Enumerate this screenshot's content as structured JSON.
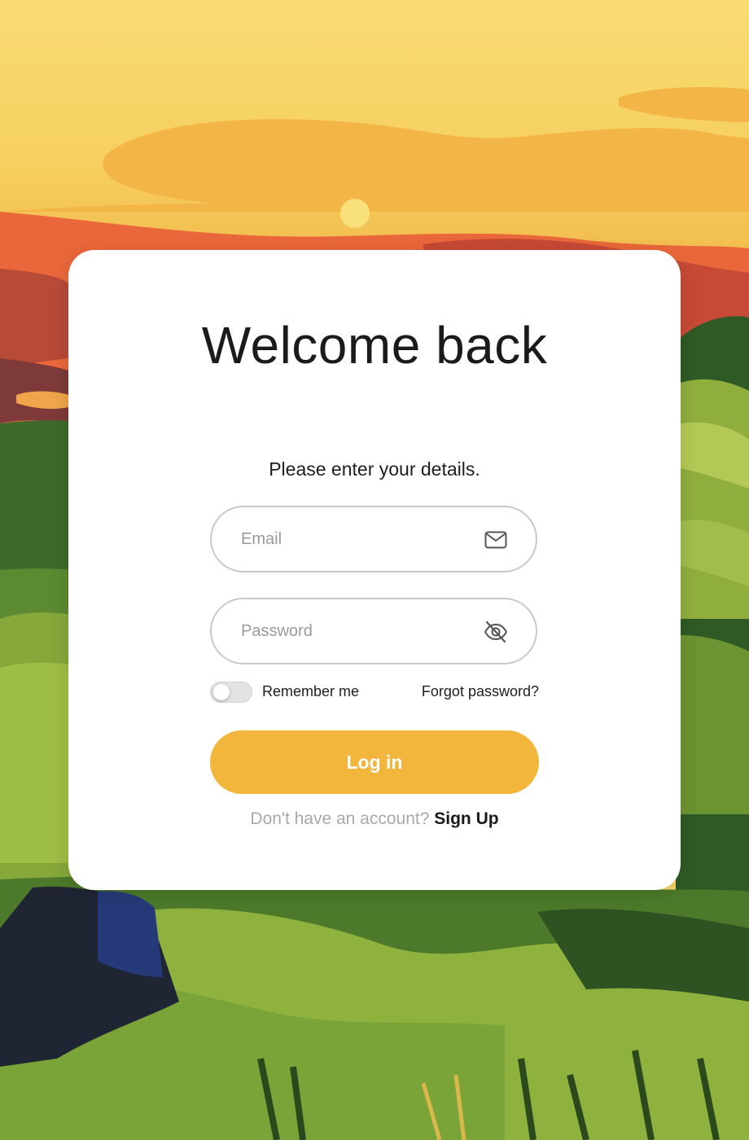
{
  "theme": {
    "accent": "#f2b63c",
    "card_background": "#ffffff",
    "field_border": "#c9c9c9"
  },
  "login": {
    "title": "Welcome back",
    "subtitle": "Please enter your details.",
    "email": {
      "placeholder": "Email",
      "value": "",
      "icon": "mail-icon"
    },
    "password": {
      "placeholder": "Password",
      "value": "",
      "icon": "eye-off-icon"
    },
    "remember_me": {
      "label": "Remember me",
      "checked": false
    },
    "forgot_password": "Forgot password?",
    "submit_label": "Log in",
    "signup_prompt": "Don't have an account?",
    "signup_link": "Sign Up"
  }
}
